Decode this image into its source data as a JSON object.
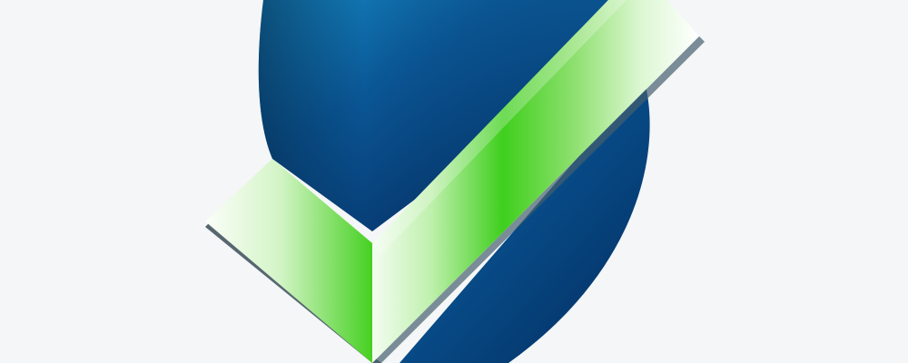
{
  "image": {
    "icon": "shield-check-icon",
    "colors": {
      "background": "#f4f6f7",
      "shield_light": "#0f7fb8",
      "shield_mid": "#0a4f8f",
      "shield_dark": "#062a56",
      "check_green": "#3fcf1d",
      "check_light": "#ebfbe6",
      "check_edge": "#5a6f7a"
    }
  }
}
